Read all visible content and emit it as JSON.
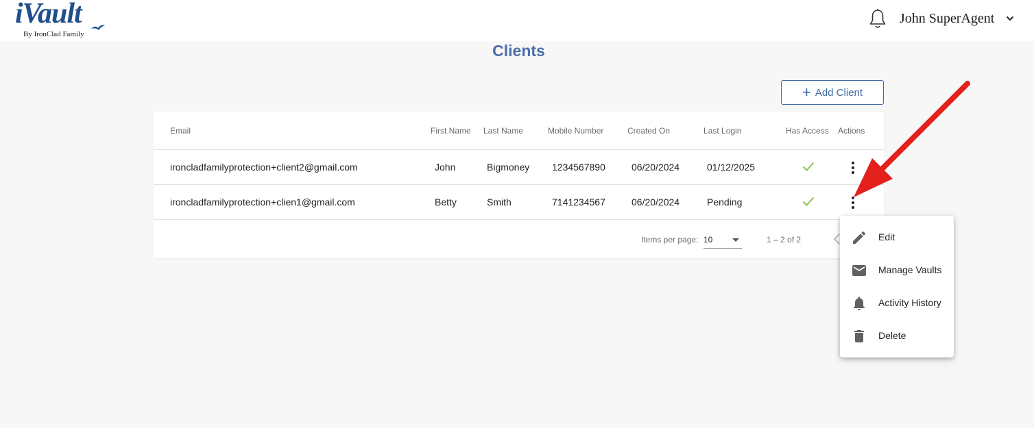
{
  "header": {
    "logo_text": "iVault",
    "logo_subtext": "By IronClad Family",
    "user_name": "John SuperAgent"
  },
  "page": {
    "title": "Clients",
    "add_button_label": "Add Client"
  },
  "table": {
    "columns": [
      "Email",
      "First Name",
      "Last Name",
      "Mobile Number",
      "Created On",
      "Last Login",
      "Has Access",
      "Actions"
    ],
    "rows": [
      {
        "email": "ironcladfamilyprotection+client2@gmail.com",
        "first_name": "John",
        "last_name": "Bigmoney",
        "mobile": "1234567890",
        "created_on": "06/20/2024",
        "last_login": "01/12/2025"
      },
      {
        "email": "ironcladfamilyprotection+clien1@gmail.com",
        "first_name": "Betty",
        "last_name": "Smith",
        "mobile": "7141234567",
        "created_on": "06/20/2024",
        "last_login": "Pending"
      }
    ]
  },
  "paginator": {
    "items_per_page_label": "Items per page:",
    "items_per_page_value": "10",
    "range_label": "1 – 2 of 2"
  },
  "context_menu": {
    "items": [
      {
        "label": "Edit",
        "icon": "pencil-icon"
      },
      {
        "label": "Manage Vaults",
        "icon": "envelope-icon"
      },
      {
        "label": "Activity History",
        "icon": "bell-icon"
      },
      {
        "label": "Delete",
        "icon": "trash-icon"
      }
    ]
  },
  "colors": {
    "accent": "#3f6aa3",
    "title": "#4a6fa8",
    "logo": "#1f4f8c",
    "check": "#8bc34a",
    "annotation_arrow": "#e3201b"
  }
}
